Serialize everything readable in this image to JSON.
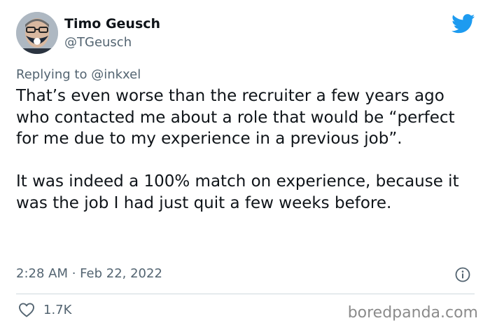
{
  "author": {
    "name": "Timo Geusch",
    "handle": "@TGeusch",
    "avatar_icon": "profile-avatar"
  },
  "reply_context": {
    "prefix": "Replying to",
    "mention": "@inkxel"
  },
  "tweet": {
    "paragraph_1": "That’s even worse than the recruiter a few years ago who contacted me about a role that would be “perfect for me due to my experience in a previous job”.",
    "paragraph_2": "It was indeed a 100% match on experience, because it was the job I had just quit a few weeks before.",
    "timestamp": "2:28 AM · Feb 22, 2022"
  },
  "engagement": {
    "likes": "1.7K",
    "like_icon": "heart-icon"
  },
  "icons": {
    "brand": "twitter-bird-icon",
    "info": "info-icon"
  },
  "colors": {
    "brand": "#1d9bf0",
    "secondary_text": "#536471",
    "primary_text": "#0f1419",
    "divider": "#cfd9de"
  },
  "watermark": "boredpanda.com"
}
